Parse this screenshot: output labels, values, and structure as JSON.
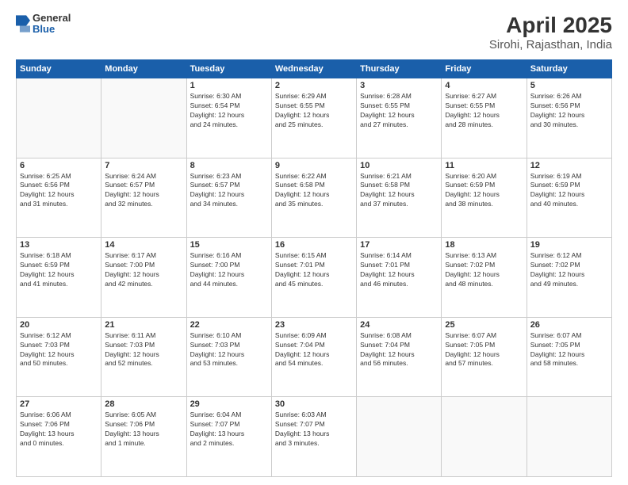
{
  "header": {
    "logo": {
      "general": "General",
      "blue": "Blue"
    },
    "title": "April 2025",
    "subtitle": "Sirohi, Rajasthan, India"
  },
  "calendar": {
    "weekdays": [
      "Sunday",
      "Monday",
      "Tuesday",
      "Wednesday",
      "Thursday",
      "Friday",
      "Saturday"
    ],
    "weeks": [
      [
        {
          "day": "",
          "info": ""
        },
        {
          "day": "",
          "info": ""
        },
        {
          "day": "1",
          "info": "Sunrise: 6:30 AM\nSunset: 6:54 PM\nDaylight: 12 hours\nand 24 minutes."
        },
        {
          "day": "2",
          "info": "Sunrise: 6:29 AM\nSunset: 6:55 PM\nDaylight: 12 hours\nand 25 minutes."
        },
        {
          "day": "3",
          "info": "Sunrise: 6:28 AM\nSunset: 6:55 PM\nDaylight: 12 hours\nand 27 minutes."
        },
        {
          "day": "4",
          "info": "Sunrise: 6:27 AM\nSunset: 6:55 PM\nDaylight: 12 hours\nand 28 minutes."
        },
        {
          "day": "5",
          "info": "Sunrise: 6:26 AM\nSunset: 6:56 PM\nDaylight: 12 hours\nand 30 minutes."
        }
      ],
      [
        {
          "day": "6",
          "info": "Sunrise: 6:25 AM\nSunset: 6:56 PM\nDaylight: 12 hours\nand 31 minutes."
        },
        {
          "day": "7",
          "info": "Sunrise: 6:24 AM\nSunset: 6:57 PM\nDaylight: 12 hours\nand 32 minutes."
        },
        {
          "day": "8",
          "info": "Sunrise: 6:23 AM\nSunset: 6:57 PM\nDaylight: 12 hours\nand 34 minutes."
        },
        {
          "day": "9",
          "info": "Sunrise: 6:22 AM\nSunset: 6:58 PM\nDaylight: 12 hours\nand 35 minutes."
        },
        {
          "day": "10",
          "info": "Sunrise: 6:21 AM\nSunset: 6:58 PM\nDaylight: 12 hours\nand 37 minutes."
        },
        {
          "day": "11",
          "info": "Sunrise: 6:20 AM\nSunset: 6:59 PM\nDaylight: 12 hours\nand 38 minutes."
        },
        {
          "day": "12",
          "info": "Sunrise: 6:19 AM\nSunset: 6:59 PM\nDaylight: 12 hours\nand 40 minutes."
        }
      ],
      [
        {
          "day": "13",
          "info": "Sunrise: 6:18 AM\nSunset: 6:59 PM\nDaylight: 12 hours\nand 41 minutes."
        },
        {
          "day": "14",
          "info": "Sunrise: 6:17 AM\nSunset: 7:00 PM\nDaylight: 12 hours\nand 42 minutes."
        },
        {
          "day": "15",
          "info": "Sunrise: 6:16 AM\nSunset: 7:00 PM\nDaylight: 12 hours\nand 44 minutes."
        },
        {
          "day": "16",
          "info": "Sunrise: 6:15 AM\nSunset: 7:01 PM\nDaylight: 12 hours\nand 45 minutes."
        },
        {
          "day": "17",
          "info": "Sunrise: 6:14 AM\nSunset: 7:01 PM\nDaylight: 12 hours\nand 46 minutes."
        },
        {
          "day": "18",
          "info": "Sunrise: 6:13 AM\nSunset: 7:02 PM\nDaylight: 12 hours\nand 48 minutes."
        },
        {
          "day": "19",
          "info": "Sunrise: 6:12 AM\nSunset: 7:02 PM\nDaylight: 12 hours\nand 49 minutes."
        }
      ],
      [
        {
          "day": "20",
          "info": "Sunrise: 6:12 AM\nSunset: 7:03 PM\nDaylight: 12 hours\nand 50 minutes."
        },
        {
          "day": "21",
          "info": "Sunrise: 6:11 AM\nSunset: 7:03 PM\nDaylight: 12 hours\nand 52 minutes."
        },
        {
          "day": "22",
          "info": "Sunrise: 6:10 AM\nSunset: 7:03 PM\nDaylight: 12 hours\nand 53 minutes."
        },
        {
          "day": "23",
          "info": "Sunrise: 6:09 AM\nSunset: 7:04 PM\nDaylight: 12 hours\nand 54 minutes."
        },
        {
          "day": "24",
          "info": "Sunrise: 6:08 AM\nSunset: 7:04 PM\nDaylight: 12 hours\nand 56 minutes."
        },
        {
          "day": "25",
          "info": "Sunrise: 6:07 AM\nSunset: 7:05 PM\nDaylight: 12 hours\nand 57 minutes."
        },
        {
          "day": "26",
          "info": "Sunrise: 6:07 AM\nSunset: 7:05 PM\nDaylight: 12 hours\nand 58 minutes."
        }
      ],
      [
        {
          "day": "27",
          "info": "Sunrise: 6:06 AM\nSunset: 7:06 PM\nDaylight: 13 hours\nand 0 minutes."
        },
        {
          "day": "28",
          "info": "Sunrise: 6:05 AM\nSunset: 7:06 PM\nDaylight: 13 hours\nand 1 minute."
        },
        {
          "day": "29",
          "info": "Sunrise: 6:04 AM\nSunset: 7:07 PM\nDaylight: 13 hours\nand 2 minutes."
        },
        {
          "day": "30",
          "info": "Sunrise: 6:03 AM\nSunset: 7:07 PM\nDaylight: 13 hours\nand 3 minutes."
        },
        {
          "day": "",
          "info": ""
        },
        {
          "day": "",
          "info": ""
        },
        {
          "day": "",
          "info": ""
        }
      ]
    ]
  }
}
